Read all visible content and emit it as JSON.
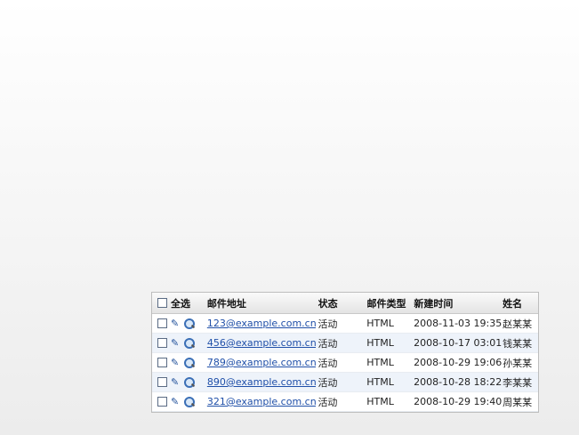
{
  "table": {
    "headers": {
      "select_all": "全选",
      "email": "邮件地址",
      "status": "状态",
      "mail_type": "邮件类型",
      "created": "新建时间",
      "name": "姓名"
    },
    "rows": [
      {
        "email": "123@example.com.cn",
        "status": "活动",
        "type": "HTML",
        "created": "2008-11-03 19:35",
        "name": "赵某某"
      },
      {
        "email": "456@example.com.cn",
        "status": "活动",
        "type": "HTML",
        "created": "2008-10-17 03:01",
        "name": "钱某某"
      },
      {
        "email": "789@example.com.cn",
        "status": "活动",
        "type": "HTML",
        "created": "2008-10-29 19:06",
        "name": "孙某某"
      },
      {
        "email": "890@example.com.cn",
        "status": "活动",
        "type": "HTML",
        "created": "2008-10-28 18:22",
        "name": "李某某"
      },
      {
        "email": "321@example.com.cn",
        "status": "活动",
        "type": "HTML",
        "created": "2008-10-29 19:40",
        "name": "周某某"
      }
    ]
  }
}
